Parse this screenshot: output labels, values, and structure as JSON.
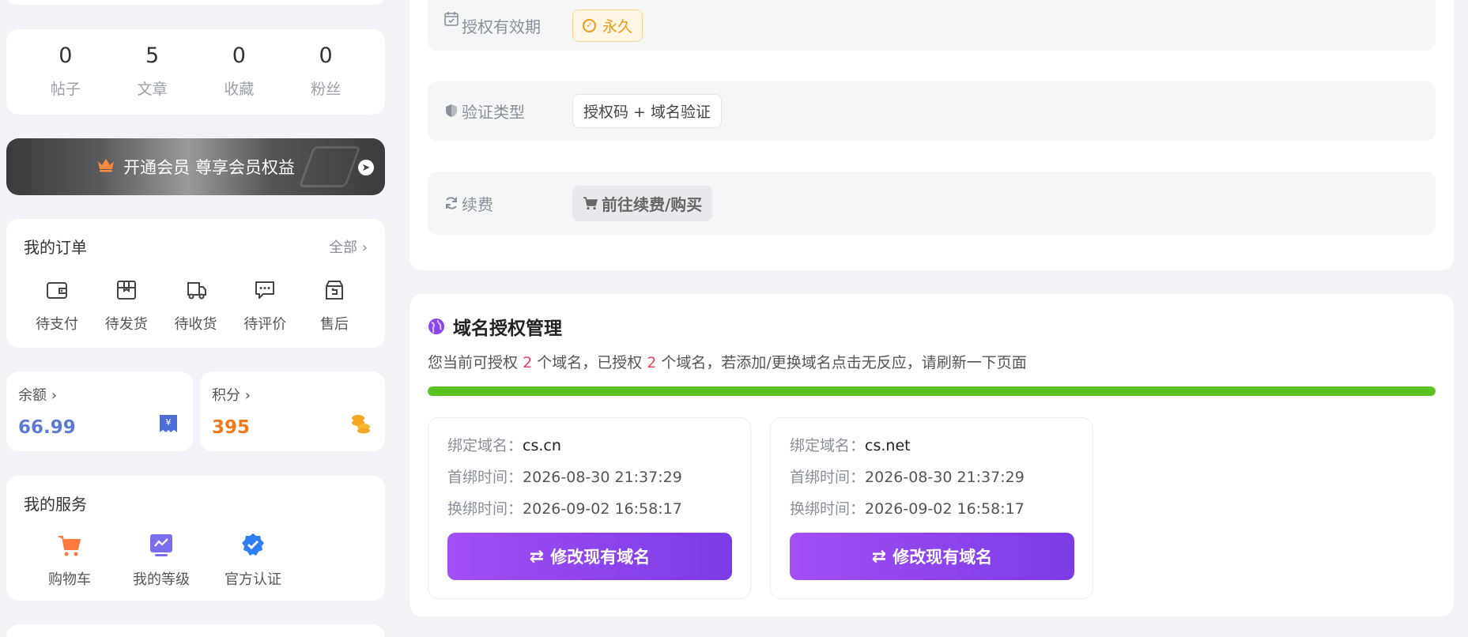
{
  "stats": [
    {
      "value": "0",
      "label": "帖子"
    },
    {
      "value": "5",
      "label": "文章"
    },
    {
      "value": "0",
      "label": "收藏"
    },
    {
      "value": "0",
      "label": "粉丝"
    }
  ],
  "vip": {
    "text": "开通会员 尊享会员权益",
    "icon": "crown-icon"
  },
  "orders": {
    "title": "我的订单",
    "all_label": "全部",
    "items": [
      {
        "label": "待支付",
        "icon": "wallet-icon"
      },
      {
        "label": "待发货",
        "icon": "package-icon"
      },
      {
        "label": "待收货",
        "icon": "truck-icon"
      },
      {
        "label": "待评价",
        "icon": "comment-icon"
      },
      {
        "label": "售后",
        "icon": "after-sales-icon"
      }
    ]
  },
  "balance": {
    "label": "余额",
    "value": "66.99"
  },
  "points": {
    "label": "积分",
    "value": "395"
  },
  "services": {
    "title": "我的服务",
    "items": [
      {
        "label": "购物车",
        "icon": "cart-icon"
      },
      {
        "label": "我的等级",
        "icon": "level-icon"
      },
      {
        "label": "官方认证",
        "icon": "verified-icon"
      }
    ]
  },
  "license": {
    "validity_label": "授权有效期",
    "validity_value": "永久",
    "verify_label": "验证类型",
    "verify_value": "授权码 + 域名验证",
    "renew_label": "续费",
    "renew_button": "前往续费/购买"
  },
  "domains": {
    "title": "域名授权管理",
    "desc_prefix": "您当前可授权",
    "allowed": "2",
    "desc_mid": "个域名，已授权",
    "used": "2",
    "desc_suffix": "个域名，若添加/更换域名点击无反应，请刷新一下页面",
    "progress_percent": 100,
    "bound_label": "绑定域名：",
    "first_label": "首绑时间：",
    "rebind_label": "换绑时间：",
    "button_label": "修改现有域名",
    "items": [
      {
        "domain": "cs.cn",
        "first_bind": "2026-08-30 21:37:29",
        "rebind": "2026-09-02 16:58:17"
      },
      {
        "domain": "cs.net",
        "first_bind": "2026-08-30 21:37:29",
        "rebind": "2026-09-02 16:58:17"
      }
    ]
  },
  "colors": {
    "accent_purple": "#8b45ec",
    "progress_green": "#5cc21f",
    "points_orange": "#f07a1a",
    "balance_blue": "#5b7bd5"
  }
}
